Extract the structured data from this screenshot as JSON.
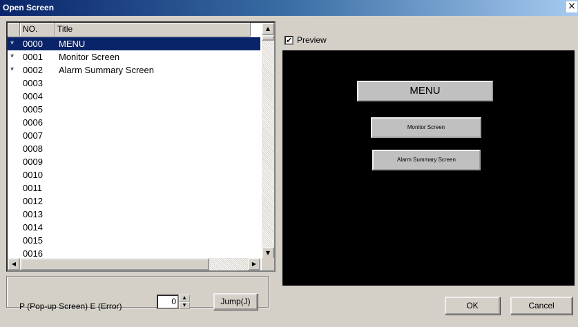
{
  "window": {
    "title": "Open Screen",
    "close_glyph": "×"
  },
  "list": {
    "headers": {
      "no": "NO.",
      "title": "Title"
    },
    "rows": [
      {
        "marker": "*",
        "no": "0000",
        "title": "MENU",
        "selected": true
      },
      {
        "marker": "*",
        "no": "0001",
        "title": "Monitor Screen",
        "selected": false
      },
      {
        "marker": "*",
        "no": "0002",
        "title": "Alarm Summary Screen",
        "selected": false
      },
      {
        "marker": "",
        "no": "0003",
        "title": "",
        "selected": false
      },
      {
        "marker": "",
        "no": "0004",
        "title": "",
        "selected": false
      },
      {
        "marker": "",
        "no": "0005",
        "title": "",
        "selected": false
      },
      {
        "marker": "",
        "no": "0006",
        "title": "",
        "selected": false
      },
      {
        "marker": "",
        "no": "0007",
        "title": "",
        "selected": false
      },
      {
        "marker": "",
        "no": "0008",
        "title": "",
        "selected": false
      },
      {
        "marker": "",
        "no": "0009",
        "title": "",
        "selected": false
      },
      {
        "marker": "",
        "no": "0010",
        "title": "",
        "selected": false
      },
      {
        "marker": "",
        "no": "0011",
        "title": "",
        "selected": false
      },
      {
        "marker": "",
        "no": "0012",
        "title": "",
        "selected": false
      },
      {
        "marker": "",
        "no": "0013",
        "title": "",
        "selected": false
      },
      {
        "marker": "",
        "no": "0014",
        "title": "",
        "selected": false
      },
      {
        "marker": "",
        "no": "0015",
        "title": "",
        "selected": false
      },
      {
        "marker": "",
        "no": "0016",
        "title": "",
        "selected": false
      }
    ],
    "scroll_up_glyph": "▲",
    "scroll_down_glyph": "▼",
    "scroll_left_glyph": "◀",
    "scroll_right_glyph": "▶"
  },
  "bottom": {
    "mode_label": "P (Pop-up Screen) E (Error)",
    "spin_value": "0",
    "spin_up_glyph": "▲",
    "spin_down_glyph": "▼",
    "jump_label": "Jump(J)",
    "ok_label": "OK",
    "cancel_label": "Cancel"
  },
  "preview": {
    "checkbox_label": "Preview",
    "checked": true,
    "check_glyph": "✔",
    "buttons": {
      "menu": "MENU",
      "monitor": "Monitor Screen",
      "alarm": "Alarm Summary Screen"
    }
  },
  "colors": {
    "selection": "#0a246a",
    "dialog": "#d4d0c8",
    "preview_bg": "#000000"
  }
}
